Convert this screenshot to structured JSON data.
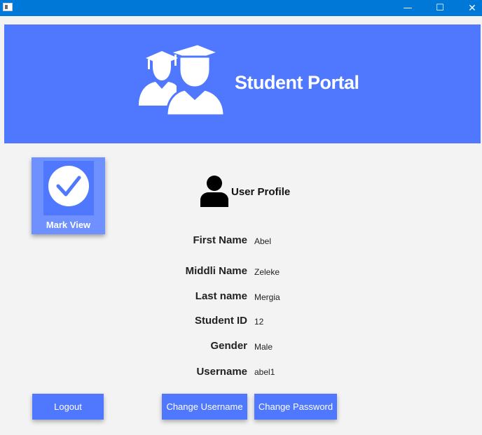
{
  "window": {
    "minimize_glyph": "—",
    "maximize_glyph": "☐",
    "close_glyph": "✕"
  },
  "banner": {
    "title": "Student Portal",
    "icon": "graduates-icon",
    "color": "#4f78ff"
  },
  "mark_view": {
    "label": "Mark View",
    "icon": "checkmark-circle-icon"
  },
  "profile": {
    "title": "User Profile",
    "icon": "user-icon",
    "fields": {
      "first_name": {
        "label": "First Name",
        "value": "Abel"
      },
      "middle_name": {
        "label": "Middli Name",
        "value": "Zeleke"
      },
      "last_name": {
        "label": "Last name",
        "value": "Mergia"
      },
      "student_id": {
        "label": "Student ID",
        "value": "12"
      },
      "gender": {
        "label": "Gender",
        "value": "Male"
      },
      "username": {
        "label": "Username",
        "value": "abel1"
      }
    }
  },
  "buttons": {
    "logout": "Logout",
    "change_username": "Change Username",
    "change_password": "Change Password"
  },
  "colors": {
    "titlebar": "#0078d7",
    "accent": "#4f78ff",
    "accent_light": "#6e91ff",
    "background": "#f3f3f3"
  }
}
